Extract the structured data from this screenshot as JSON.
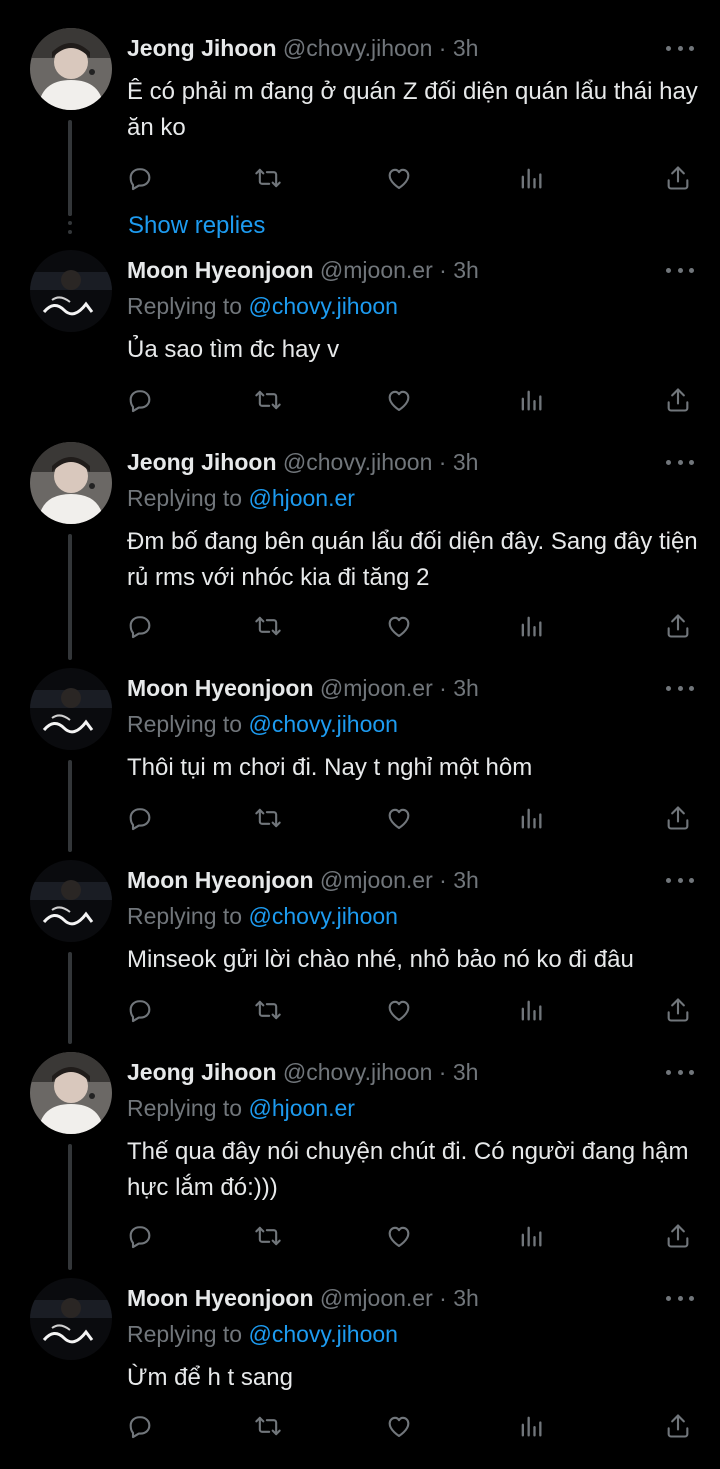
{
  "show_replies": "Show replies",
  "replying_prefix": "Replying to",
  "tweets": [
    {
      "name": "Jeong Jihoon",
      "handle": "@chovy.jihoon",
      "sep": "·",
      "time": "3h",
      "replying_to": "",
      "text": "Ê có phải m đang ở quán Z đối diện quán lẩu thái hay ăn ko",
      "avatar": "jihoon"
    },
    {
      "name": "Moon Hyeonjoon",
      "handle": "@mjoon.er",
      "sep": "·",
      "time": "3h",
      "replying_to": "@chovy.jihoon",
      "text": "Ủa sao tìm đc hay v",
      "avatar": "hyeonjoon"
    },
    {
      "name": "Jeong Jihoon",
      "handle": "@chovy.jihoon",
      "sep": "·",
      "time": "3h",
      "replying_to": "@hjoon.er",
      "text": "Đm bố đang bên quán lẩu đối diện đây. Sang đây tiện rủ rms với nhóc kia đi tăng 2",
      "avatar": "jihoon"
    },
    {
      "name": "Moon Hyeonjoon",
      "handle": "@mjoon.er",
      "sep": "·",
      "time": "3h",
      "replying_to": "@chovy.jihoon",
      "text": "Thôi tụi m chơi đi. Nay t nghỉ một hôm",
      "avatar": "hyeonjoon"
    },
    {
      "name": "Moon Hyeonjoon",
      "handle": "@mjoon.er",
      "sep": "·",
      "time": "3h",
      "replying_to": "@chovy.jihoon",
      "text": "Minseok gửi lời chào nhé, nhỏ bảo nó ko đi đâu",
      "avatar": "hyeonjoon"
    },
    {
      "name": "Jeong Jihoon",
      "handle": "@chovy.jihoon",
      "sep": "·",
      "time": "3h",
      "replying_to": "@hjoon.er",
      "text": "Thế qua đây nói chuyện chút đi. Có người đang hậm hực lắm đó:)))",
      "avatar": "jihoon"
    },
    {
      "name": "Moon Hyeonjoon",
      "handle": "@mjoon.er",
      "sep": "·",
      "time": "3h",
      "replying_to": "@chovy.jihoon",
      "text": "Ừm để h t sang",
      "avatar": "hyeonjoon"
    }
  ],
  "action_icons": [
    "reply-icon",
    "retweet-icon",
    "like-icon",
    "views-icon",
    "share-icon"
  ],
  "colors": {
    "background": "#000000",
    "text": "#e7e9ea",
    "muted": "#71767b",
    "link": "#1d9bf0",
    "thread_line": "#333639"
  }
}
